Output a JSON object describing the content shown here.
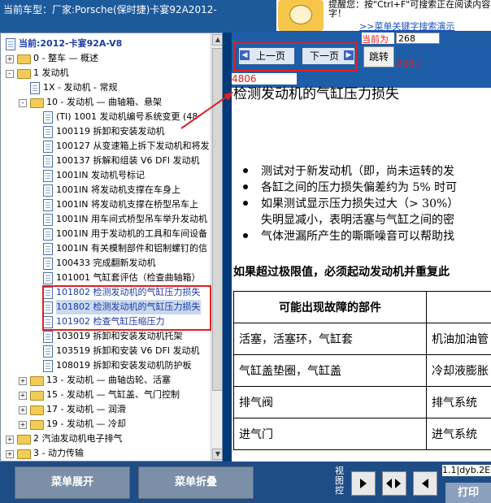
{
  "header": {
    "vehicle": "当前车型：厂家:Porsche(保时捷)卡宴92A2012-",
    "hint_text_1": "提醒您：按\"Ctrl+F\"可搜索正在阅读内容的",
    "hint_text_2": "字！",
    "hint_link": ">>菜单关键字搜索演示"
  },
  "tree": {
    "root": "当前:2012-卡宴92A-V8",
    "items": [
      {
        "indent": 0,
        "pm": "+",
        "icon": "folder",
        "label": "0 - 整车 — 概述"
      },
      {
        "indent": 0,
        "pm": "-",
        "icon": "folder",
        "label": "1 发动机"
      },
      {
        "indent": 1,
        "pm": "",
        "icon": "doc",
        "label": "1X - 发动机 - 常规"
      },
      {
        "indent": 1,
        "pm": "-",
        "icon": "folder",
        "label": "10 - 发动机 — 曲轴箱、悬架"
      },
      {
        "indent": 2,
        "pm": "",
        "icon": "doc",
        "label": "(TI) 1001 发动机编号系统变更 (48"
      },
      {
        "indent": 2,
        "pm": "",
        "icon": "doc",
        "label": "100119 拆卸和安装发动机"
      },
      {
        "indent": 2,
        "pm": "",
        "icon": "doc",
        "label": "100127 从变速箱上拆下发动机和将发"
      },
      {
        "indent": 2,
        "pm": "",
        "icon": "doc",
        "label": "100137 拆解和组装 V6 DFI 发动机"
      },
      {
        "indent": 2,
        "pm": "",
        "icon": "doc",
        "label": "1001IN 发动机号标记"
      },
      {
        "indent": 2,
        "pm": "",
        "icon": "doc",
        "label": "1001IN 将发动机支撑在车身上"
      },
      {
        "indent": 2,
        "pm": "",
        "icon": "doc",
        "label": "1001IN 将发动机支撑在桥型吊车上"
      },
      {
        "indent": 2,
        "pm": "",
        "icon": "doc",
        "label": "1001IN 用车间式桥型吊车举升发动机"
      },
      {
        "indent": 2,
        "pm": "",
        "icon": "doc",
        "label": "1001IN 用于发动机的工具和车间设备"
      },
      {
        "indent": 2,
        "pm": "",
        "icon": "doc",
        "label": "1001IN 有关模制部件和铝制螺钉的信"
      },
      {
        "indent": 2,
        "pm": "",
        "icon": "doc",
        "label": "100433 完成翻新发动机"
      },
      {
        "indent": 2,
        "pm": "",
        "icon": "doc",
        "label": "101001 气缸套评估（检查曲轴箱）"
      },
      {
        "indent": 2,
        "pm": "",
        "icon": "doc",
        "label": "101802 检测发动机的气缸压力损失",
        "hl": true
      },
      {
        "indent": 2,
        "pm": "",
        "icon": "doc",
        "label": "101802 检测发动机的气缸压力损失",
        "sel": true
      },
      {
        "indent": 2,
        "pm": "",
        "icon": "doc",
        "label": "101902 检查气缸压缩压力",
        "hl": true
      },
      {
        "indent": 2,
        "pm": "",
        "icon": "doc",
        "label": "103019 拆卸和安装发动机托架"
      },
      {
        "indent": 2,
        "pm": "",
        "icon": "doc",
        "label": "103519 拆卸和安装 V6 DFI 发动机"
      },
      {
        "indent": 2,
        "pm": "",
        "icon": "doc",
        "label": "108019 拆卸和安装发动机防护板"
      },
      {
        "indent": 1,
        "pm": "+",
        "icon": "folder",
        "label": "13 - 发动机 — 曲轴齿轮、活塞"
      },
      {
        "indent": 1,
        "pm": "+",
        "icon": "folder",
        "label": "15 - 发动机 — 气缸盖、气门控制"
      },
      {
        "indent": 1,
        "pm": "+",
        "icon": "folder",
        "label": "17 - 发动机 — 润滑"
      },
      {
        "indent": 1,
        "pm": "+",
        "icon": "folder",
        "label": "19 - 发动机 — 冷却"
      },
      {
        "indent": 0,
        "pm": "+",
        "icon": "folder",
        "label": "2 汽油发动机电子排气"
      },
      {
        "indent": 0,
        "pm": "+",
        "icon": "folder",
        "label": "3 - 动力传输"
      }
    ]
  },
  "nav": {
    "current_page_label": "当前为",
    "current_page_value": "268",
    "prev_label": "上一页",
    "next_label": "下一页",
    "jump_label": "跳转",
    "page_count_a": "268 /",
    "page_count_b": "4806"
  },
  "doc": {
    "title": "检测发动机的气缸压力损失",
    "bullets": [
      "测试对于新发动机（即，尚未运转的发",
      "各缸之间的压力损失偏差约为  5% 时可",
      "如果测试显示压力损失过大（> 30%）",
      "失明显减小，表明活塞与气缸之间的密",
      "气体泄漏所产生的嘶嘶噪音可以帮助找"
    ],
    "warning": "如果超过极限值，必须起动发动机并重复此",
    "table": {
      "header": [
        "可能出现故障的部件",
        ""
      ],
      "rows": [
        [
          "活塞，活塞环，气缸套",
          "机油加油管"
        ],
        [
          "气缸盖垫圈，气缸盖",
          "冷却液膨胀"
        ],
        [
          "排气阀",
          "排气系统"
        ],
        [
          "进气门",
          "进气系统"
        ]
      ]
    }
  },
  "bottom": {
    "expand_label": "菜单展开",
    "collapse_label": "菜单折叠",
    "view_label": "视图控",
    "status": "1.1|dyb.2E",
    "print_label": "打印"
  }
}
